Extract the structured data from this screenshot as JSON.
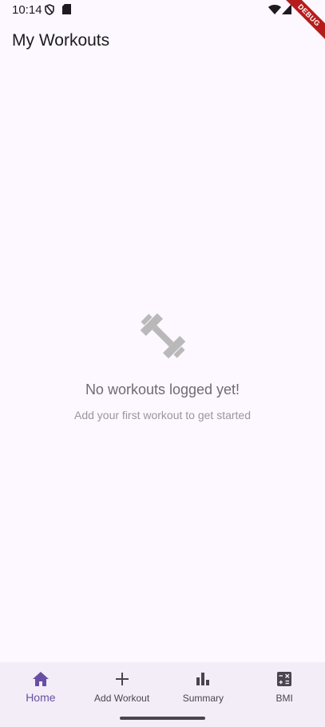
{
  "status_bar": {
    "time": "10:14",
    "icons": [
      "shield-icon",
      "sd-card-icon",
      "wifi-icon",
      "signal-icon"
    ]
  },
  "debug_banner": {
    "label": "DEBUG"
  },
  "app_bar": {
    "title": "My Workouts"
  },
  "empty_state": {
    "icon": "dumbbell-icon",
    "title": "No workouts logged yet!",
    "subtitle": "Add your first workout to get started"
  },
  "nav": {
    "items": [
      {
        "label": "Home",
        "icon": "home-icon",
        "active": true
      },
      {
        "label": "Add Workout",
        "icon": "add-icon",
        "active": false
      },
      {
        "label": "Summary",
        "icon": "bar-chart-icon",
        "active": false
      },
      {
        "label": "BMI",
        "icon": "calculator-icon",
        "active": false
      }
    ]
  },
  "colors": {
    "background": "#fdf7ff",
    "nav_background": "#f3edf7",
    "accent": "#6750a4",
    "debug_ribbon": "#b71c1c"
  }
}
